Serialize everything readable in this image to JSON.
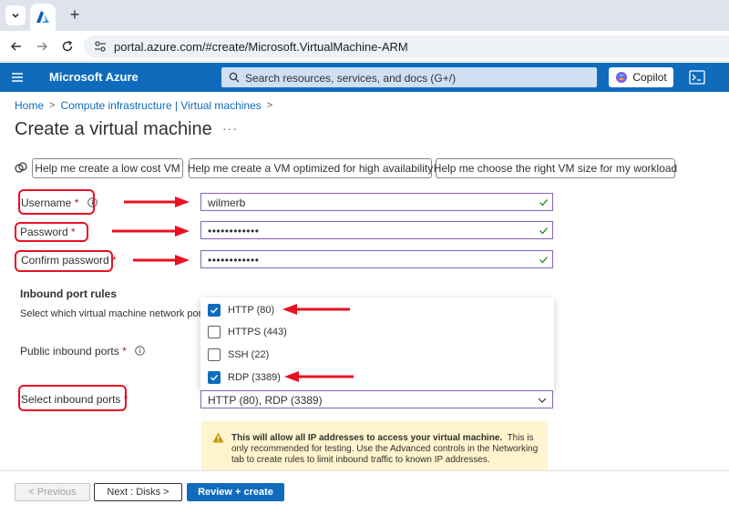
{
  "browser": {
    "url": "portal.azure.com/#create/Microsoft.VirtualMachine-ARM"
  },
  "header": {
    "brand": "Microsoft Azure",
    "search_placeholder": "Search resources, services, and docs (G+/)",
    "copilot_label": "Copilot"
  },
  "breadcrumb": {
    "items": [
      "Home",
      "Compute infrastructure | Virtual machines"
    ]
  },
  "page": {
    "title": "Create a virtual machine",
    "more": "···"
  },
  "help_buttons": [
    "Help me create a low cost VM",
    "Help me create a VM optimized for high availability",
    "Help me choose the right VM size for my workload"
  ],
  "form": {
    "username_label": "Username",
    "username_value": "wilmerb",
    "password_label": "Password",
    "password_value": "••••••••••••",
    "confirm_label": "Confirm password",
    "confirm_value": "••••••••••••",
    "required_mark": "*",
    "inbound_heading": "Inbound port rules",
    "inbound_desc": "Select which virtual machine network ports are accessible from the public internet. You can specify more limited or granular network access on the Networking tab.",
    "public_ports_label": "Public inbound ports",
    "select_ports_label": "Select inbound ports",
    "select_ports_value": "HTTP (80), RDP (3389)"
  },
  "port_options": [
    {
      "label": "HTTP (80)",
      "checked": true
    },
    {
      "label": "HTTPS (443)",
      "checked": false
    },
    {
      "label": "SSH (22)",
      "checked": false
    },
    {
      "label": "RDP (3389)",
      "checked": true
    }
  ],
  "warning": {
    "bold": "This will allow all IP addresses to access your virtual machine.",
    "text": "This is only recommended for testing.  Use the Advanced controls in the Networking tab to create rules to limit inbound traffic to known IP addresses."
  },
  "footer": {
    "previous_label": "< Previous",
    "next_label": "Next : Disks >",
    "review_label": "Review + create"
  },
  "colors": {
    "azure_blue": "#0f6cbd",
    "annotation_red": "#e81123",
    "warning_bg": "#fff4ce"
  }
}
